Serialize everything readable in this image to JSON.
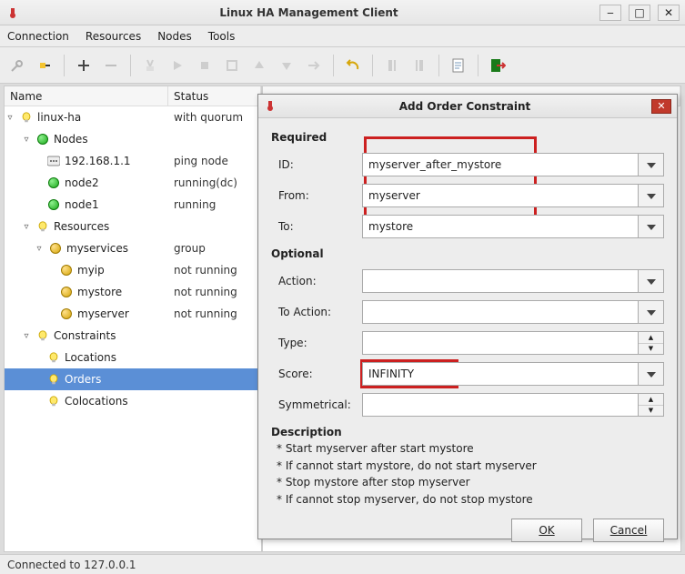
{
  "window": {
    "title": "Linux HA Management Client",
    "menus": [
      "Connection",
      "Resources",
      "Nodes",
      "Tools"
    ]
  },
  "columns": {
    "name": "Name",
    "status": "Status"
  },
  "tree": {
    "linuxha": {
      "label": "linux-ha",
      "status": "with quorum"
    },
    "nodes": {
      "label": "Nodes"
    },
    "node_ip": {
      "label": "192.168.1.1",
      "status": "ping node"
    },
    "node2": {
      "label": "node2",
      "status": "running(dc)"
    },
    "node1": {
      "label": "node1",
      "status": "running"
    },
    "resources": {
      "label": "Resources"
    },
    "myservices": {
      "label": "myservices",
      "status": "group"
    },
    "myip": {
      "label": "myip",
      "status": "not running"
    },
    "mystore": {
      "label": "mystore",
      "status": "not running"
    },
    "myserver": {
      "label": "myserver",
      "status": "not running"
    },
    "constraints": {
      "label": "Constraints"
    },
    "locations": {
      "label": "Locations"
    },
    "orders": {
      "label": "Orders"
    },
    "colocations": {
      "label": "Colocations"
    }
  },
  "status_text": "Connected to 127.0.0.1",
  "dialog": {
    "title": "Add Order Constraint",
    "required_label": "Required",
    "optional_label": "Optional",
    "fields": {
      "id": {
        "label": "ID:",
        "value": "myserver_after_mystore"
      },
      "from": {
        "label": "From:",
        "value": "myserver"
      },
      "to": {
        "label": "To:",
        "value": "mystore"
      },
      "action": {
        "label": "Action:",
        "value": ""
      },
      "to_action": {
        "label": "To Action:",
        "value": ""
      },
      "type": {
        "label": "Type:",
        "value": ""
      },
      "score": {
        "label": "Score:",
        "value": "INFINITY"
      },
      "symmetrical": {
        "label": "Symmetrical:",
        "value": ""
      }
    },
    "description_label": "Description",
    "description": [
      "* Start myserver after start mystore",
      "* If cannot start mystore, do not start myserver",
      "* Stop mystore after stop myserver",
      "* If cannot stop myserver, do not stop mystore"
    ],
    "ok": "OK",
    "cancel": "Cancel"
  }
}
